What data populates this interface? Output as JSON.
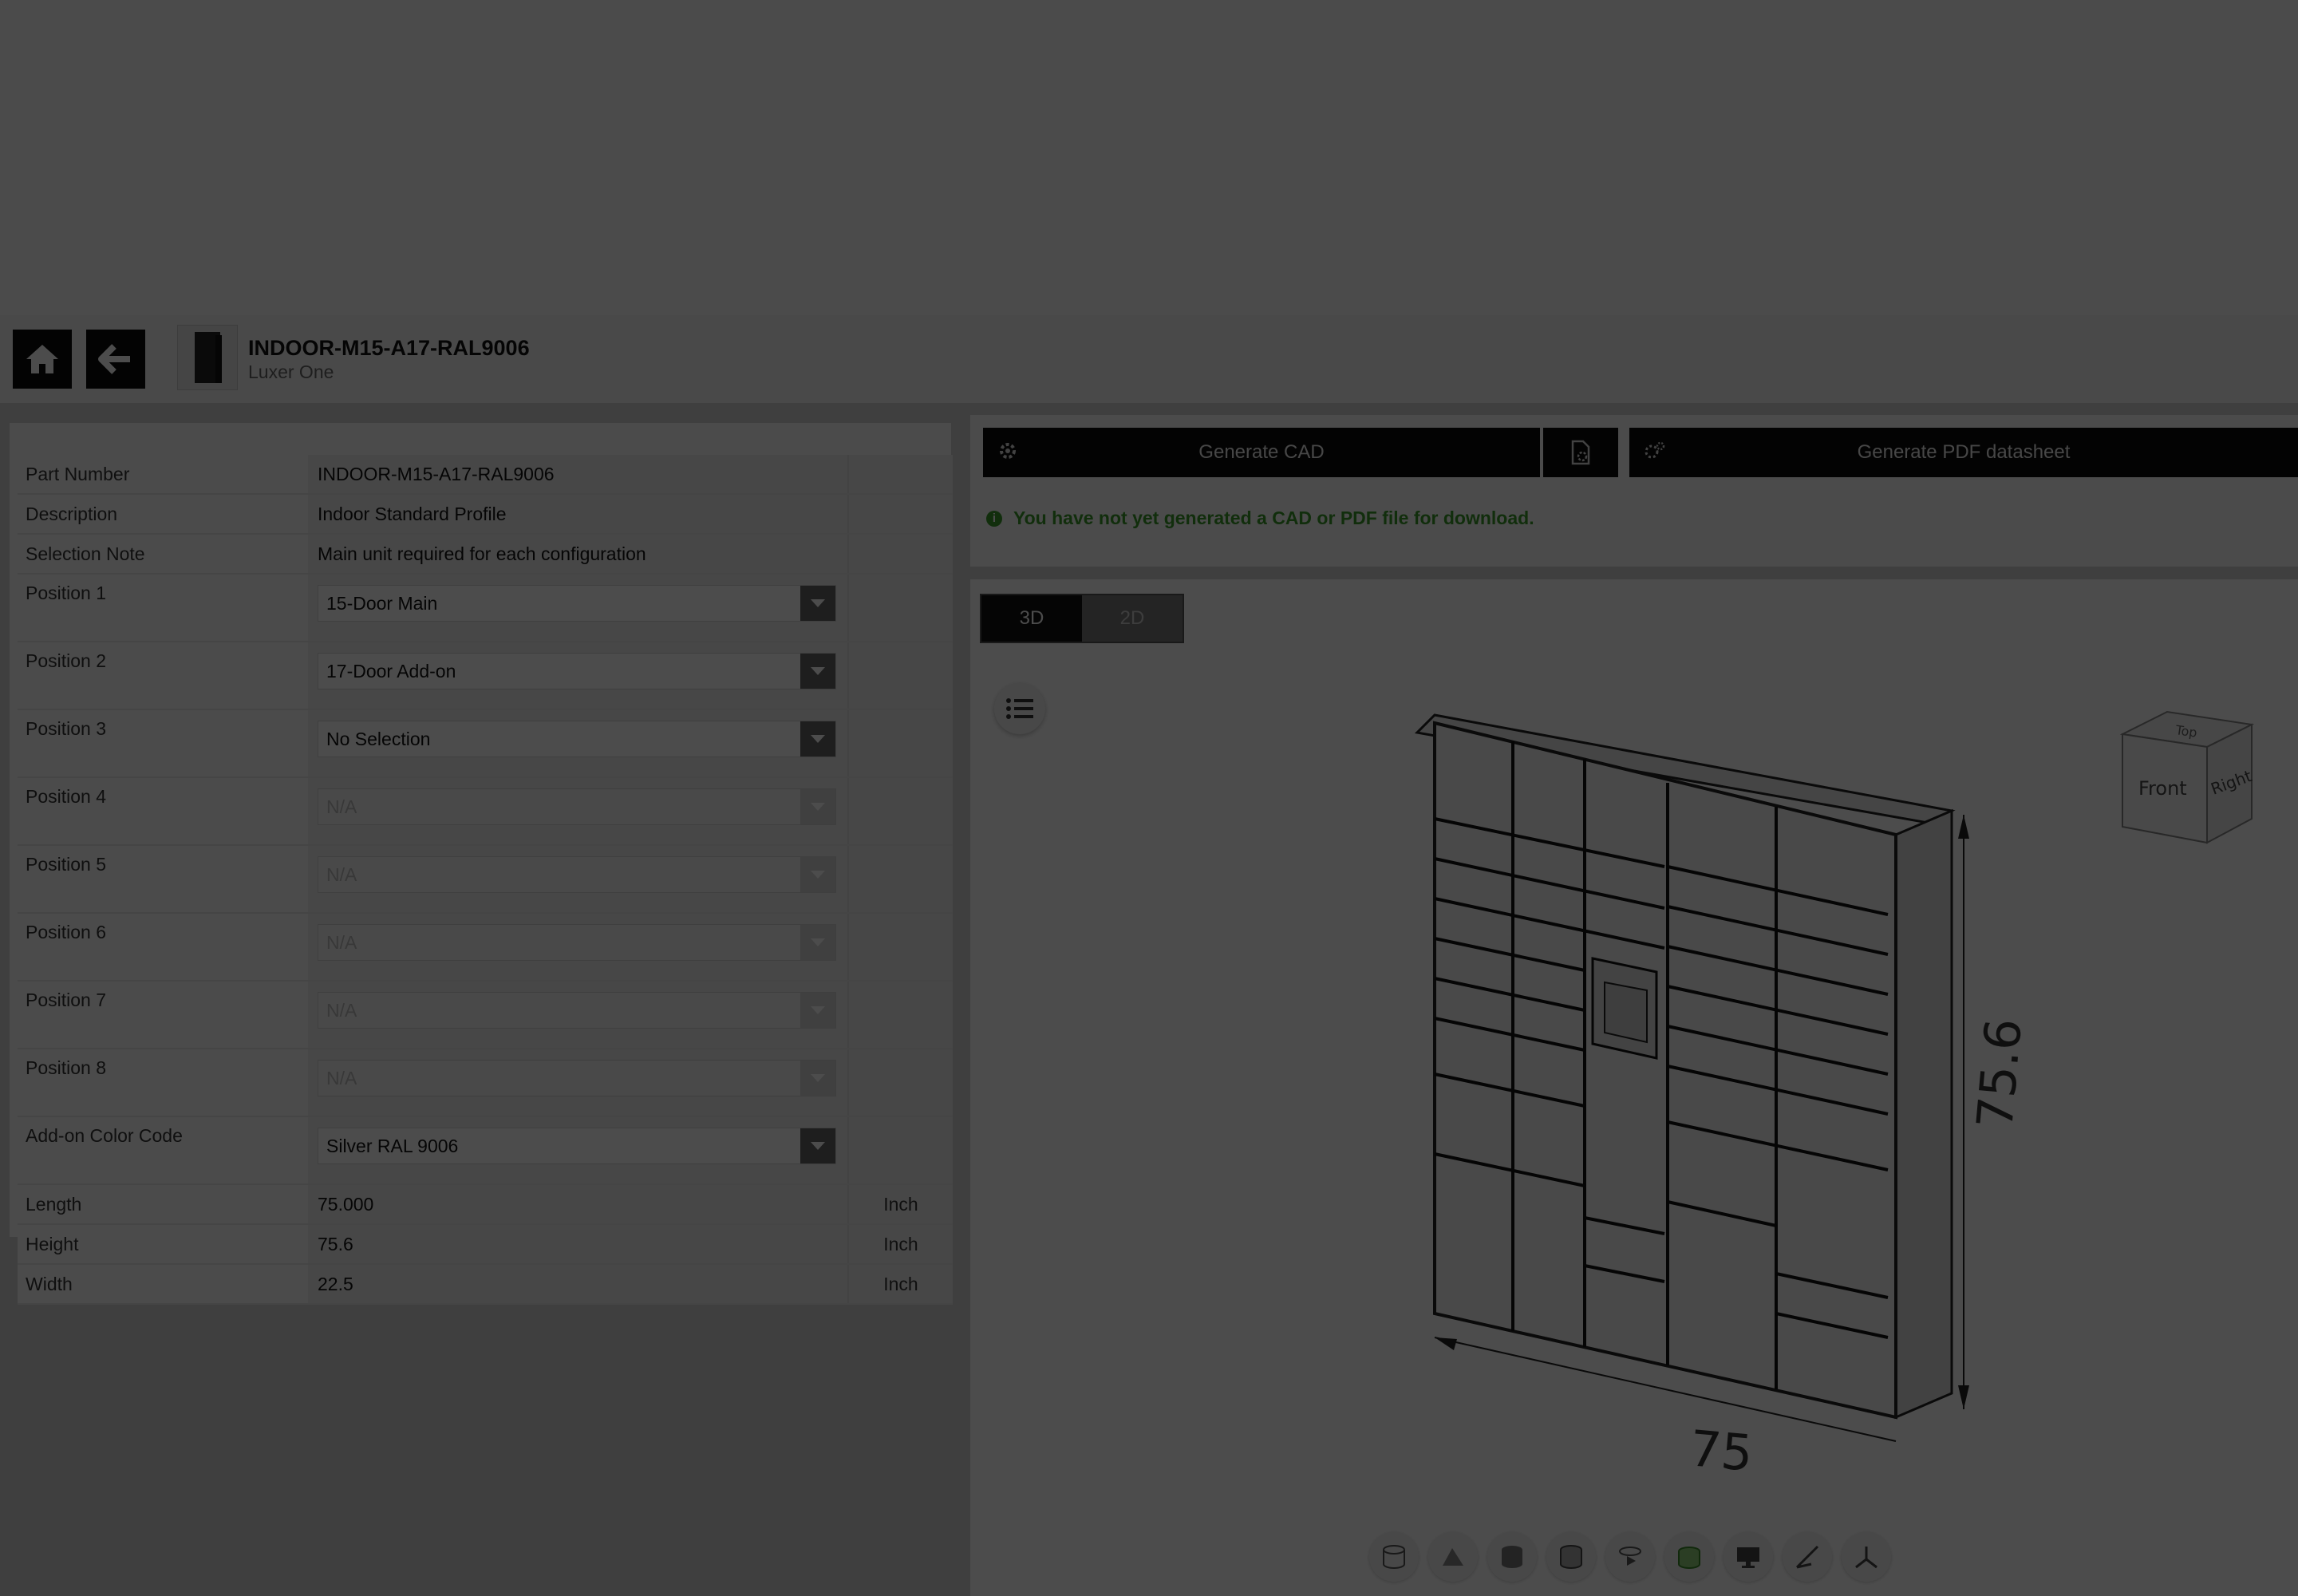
{
  "header": {
    "title": "INDOOR-M15-A17-RAL9006",
    "subtitle": "Luxer One"
  },
  "specs": {
    "rows": [
      {
        "label": "Part Number",
        "value": "INDOOR-M15-A17-RAL9006",
        "unit": ""
      },
      {
        "label": "Description",
        "value": "Indoor Standard Profile",
        "unit": ""
      },
      {
        "label": "Selection Note",
        "value": "Main unit required for each configuration",
        "unit": ""
      }
    ],
    "selects": [
      {
        "label": "Position 1",
        "value": "15-Door Main"
      },
      {
        "label": "Position 2",
        "value": "17-Door Add-on"
      },
      {
        "label": "Position 3",
        "value": "No Selection"
      },
      {
        "label": "Position 4",
        "value": "N/A"
      },
      {
        "label": "Position 5",
        "value": "N/A"
      },
      {
        "label": "Position 6",
        "value": "N/A"
      },
      {
        "label": "Position 7",
        "value": "N/A"
      },
      {
        "label": "Position 8",
        "value": "N/A"
      },
      {
        "label": "Add-on Color Code",
        "value": "Silver RAL 9006"
      }
    ],
    "dims": [
      {
        "label": "Length",
        "value": "75.000",
        "unit": "Inch"
      },
      {
        "label": "Height",
        "value": "75.6",
        "unit": "Inch"
      },
      {
        "label": "Width",
        "value": "22.5",
        "unit": "Inch"
      }
    ]
  },
  "actions": {
    "generate_cad": "Generate CAD",
    "generate_pdf": "Generate PDF datasheet",
    "info_message": "You have not yet generated a CAD or PDF file for download."
  },
  "viewer": {
    "tab_3d": "3D",
    "tab_2d": "2D",
    "dim_length": "75",
    "dim_height": "75.6",
    "cube_front": "Front",
    "cube_right": "Right",
    "cube_top": "Top"
  },
  "colors": {
    "info_green": "#3a9a2a",
    "button_black": "#0a0a0a",
    "overlay": "rgba(0,0,0,0.70)"
  }
}
